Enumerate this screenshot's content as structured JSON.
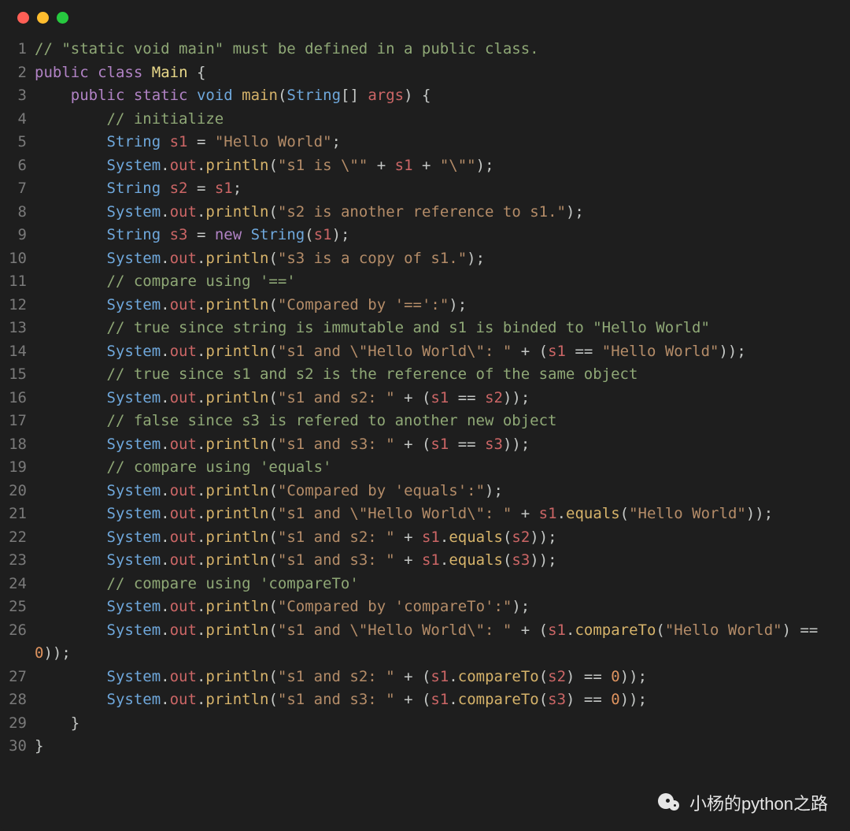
{
  "window": {
    "traffic_light_colors": {
      "close": "#ff5f56",
      "minimize": "#ffbd2e",
      "zoom": "#27c93f"
    }
  },
  "watermark": {
    "text": "小杨的python之路",
    "icon": "wechat-bubble-icon"
  },
  "code_lines": [
    {
      "n": 1,
      "tokens": [
        [
          "comment",
          "// \"static void main\" must be defined in a public class."
        ]
      ]
    },
    {
      "n": 2,
      "tokens": [
        [
          "keyword",
          "public"
        ],
        [
          "plain",
          " "
        ],
        [
          "keyword",
          "class"
        ],
        [
          "plain",
          " "
        ],
        [
          "class",
          "Main"
        ],
        [
          "plain",
          " {"
        ]
      ]
    },
    {
      "n": 3,
      "tokens": [
        [
          "plain",
          "    "
        ],
        [
          "keyword",
          "public"
        ],
        [
          "plain",
          " "
        ],
        [
          "keyword",
          "static"
        ],
        [
          "plain",
          " "
        ],
        [
          "type",
          "void"
        ],
        [
          "plain",
          " "
        ],
        [
          "method",
          "main"
        ],
        [
          "plain",
          "("
        ],
        [
          "type",
          "String"
        ],
        [
          "plain",
          "[] "
        ],
        [
          "var",
          "args"
        ],
        [
          "plain",
          ") {"
        ]
      ]
    },
    {
      "n": 4,
      "tokens": [
        [
          "plain",
          "        "
        ],
        [
          "comment",
          "// initialize"
        ]
      ]
    },
    {
      "n": 5,
      "tokens": [
        [
          "plain",
          "        "
        ],
        [
          "type",
          "String"
        ],
        [
          "plain",
          " "
        ],
        [
          "var",
          "s1"
        ],
        [
          "plain",
          " = "
        ],
        [
          "string",
          "\"Hello World\""
        ],
        [
          "plain",
          ";"
        ]
      ]
    },
    {
      "n": 6,
      "tokens": [
        [
          "plain",
          "        "
        ],
        [
          "type",
          "System"
        ],
        [
          "plain",
          "."
        ],
        [
          "field",
          "out"
        ],
        [
          "plain",
          "."
        ],
        [
          "method",
          "println"
        ],
        [
          "plain",
          "("
        ],
        [
          "string",
          "\"s1 is \\\"\""
        ],
        [
          "plain",
          " + "
        ],
        [
          "var",
          "s1"
        ],
        [
          "plain",
          " + "
        ],
        [
          "string",
          "\"\\\"\""
        ],
        [
          "plain",
          ");"
        ]
      ]
    },
    {
      "n": 7,
      "tokens": [
        [
          "plain",
          "        "
        ],
        [
          "type",
          "String"
        ],
        [
          "plain",
          " "
        ],
        [
          "var",
          "s2"
        ],
        [
          "plain",
          " = "
        ],
        [
          "var",
          "s1"
        ],
        [
          "plain",
          ";"
        ]
      ]
    },
    {
      "n": 8,
      "tokens": [
        [
          "plain",
          "        "
        ],
        [
          "type",
          "System"
        ],
        [
          "plain",
          "."
        ],
        [
          "field",
          "out"
        ],
        [
          "plain",
          "."
        ],
        [
          "method",
          "println"
        ],
        [
          "plain",
          "("
        ],
        [
          "string",
          "\"s2 is another reference to s1.\""
        ],
        [
          "plain",
          ");"
        ]
      ]
    },
    {
      "n": 9,
      "tokens": [
        [
          "plain",
          "        "
        ],
        [
          "type",
          "String"
        ],
        [
          "plain",
          " "
        ],
        [
          "var",
          "s3"
        ],
        [
          "plain",
          " = "
        ],
        [
          "keyword",
          "new"
        ],
        [
          "plain",
          " "
        ],
        [
          "type",
          "String"
        ],
        [
          "plain",
          "("
        ],
        [
          "var",
          "s1"
        ],
        [
          "plain",
          ");"
        ]
      ]
    },
    {
      "n": 10,
      "tokens": [
        [
          "plain",
          "        "
        ],
        [
          "type",
          "System"
        ],
        [
          "plain",
          "."
        ],
        [
          "field",
          "out"
        ],
        [
          "plain",
          "."
        ],
        [
          "method",
          "println"
        ],
        [
          "plain",
          "("
        ],
        [
          "string",
          "\"s3 is a copy of s1.\""
        ],
        [
          "plain",
          ");"
        ]
      ]
    },
    {
      "n": 11,
      "tokens": [
        [
          "plain",
          "        "
        ],
        [
          "comment",
          "// compare using '=='"
        ]
      ]
    },
    {
      "n": 12,
      "tokens": [
        [
          "plain",
          "        "
        ],
        [
          "type",
          "System"
        ],
        [
          "plain",
          "."
        ],
        [
          "field",
          "out"
        ],
        [
          "plain",
          "."
        ],
        [
          "method",
          "println"
        ],
        [
          "plain",
          "("
        ],
        [
          "string",
          "\"Compared by '==':\""
        ],
        [
          "plain",
          ");"
        ]
      ]
    },
    {
      "n": 13,
      "tokens": [
        [
          "plain",
          "        "
        ],
        [
          "comment",
          "// true since string is immutable and s1 is binded to \"Hello World\""
        ]
      ]
    },
    {
      "n": 14,
      "tokens": [
        [
          "plain",
          "        "
        ],
        [
          "type",
          "System"
        ],
        [
          "plain",
          "."
        ],
        [
          "field",
          "out"
        ],
        [
          "plain",
          "."
        ],
        [
          "method",
          "println"
        ],
        [
          "plain",
          "("
        ],
        [
          "string",
          "\"s1 and \\\"Hello World\\\": \""
        ],
        [
          "plain",
          " + ("
        ],
        [
          "var",
          "s1"
        ],
        [
          "plain",
          " == "
        ],
        [
          "string",
          "\"Hello World\""
        ],
        [
          "plain",
          "));"
        ]
      ]
    },
    {
      "n": 15,
      "tokens": [
        [
          "plain",
          "        "
        ],
        [
          "comment",
          "// true since s1 and s2 is the reference of the same object"
        ]
      ]
    },
    {
      "n": 16,
      "tokens": [
        [
          "plain",
          "        "
        ],
        [
          "type",
          "System"
        ],
        [
          "plain",
          "."
        ],
        [
          "field",
          "out"
        ],
        [
          "plain",
          "."
        ],
        [
          "method",
          "println"
        ],
        [
          "plain",
          "("
        ],
        [
          "string",
          "\"s1 and s2: \""
        ],
        [
          "plain",
          " + ("
        ],
        [
          "var",
          "s1"
        ],
        [
          "plain",
          " == "
        ],
        [
          "var",
          "s2"
        ],
        [
          "plain",
          "));"
        ]
      ]
    },
    {
      "n": 17,
      "tokens": [
        [
          "plain",
          "        "
        ],
        [
          "comment",
          "// false since s3 is refered to another new object"
        ]
      ]
    },
    {
      "n": 18,
      "tokens": [
        [
          "plain",
          "        "
        ],
        [
          "type",
          "System"
        ],
        [
          "plain",
          "."
        ],
        [
          "field",
          "out"
        ],
        [
          "plain",
          "."
        ],
        [
          "method",
          "println"
        ],
        [
          "plain",
          "("
        ],
        [
          "string",
          "\"s1 and s3: \""
        ],
        [
          "plain",
          " + ("
        ],
        [
          "var",
          "s1"
        ],
        [
          "plain",
          " == "
        ],
        [
          "var",
          "s3"
        ],
        [
          "plain",
          "));"
        ]
      ]
    },
    {
      "n": 19,
      "tokens": [
        [
          "plain",
          "        "
        ],
        [
          "comment",
          "// compare using 'equals'"
        ]
      ]
    },
    {
      "n": 20,
      "tokens": [
        [
          "plain",
          "        "
        ],
        [
          "type",
          "System"
        ],
        [
          "plain",
          "."
        ],
        [
          "field",
          "out"
        ],
        [
          "plain",
          "."
        ],
        [
          "method",
          "println"
        ],
        [
          "plain",
          "("
        ],
        [
          "string",
          "\"Compared by 'equals':\""
        ],
        [
          "plain",
          ");"
        ]
      ]
    },
    {
      "n": 21,
      "tokens": [
        [
          "plain",
          "        "
        ],
        [
          "type",
          "System"
        ],
        [
          "plain",
          "."
        ],
        [
          "field",
          "out"
        ],
        [
          "plain",
          "."
        ],
        [
          "method",
          "println"
        ],
        [
          "plain",
          "("
        ],
        [
          "string",
          "\"s1 and \\\"Hello World\\\": \""
        ],
        [
          "plain",
          " + "
        ],
        [
          "var",
          "s1"
        ],
        [
          "plain",
          "."
        ],
        [
          "method",
          "equals"
        ],
        [
          "plain",
          "("
        ],
        [
          "string",
          "\"Hello World\""
        ],
        [
          "plain",
          "));"
        ]
      ]
    },
    {
      "n": 22,
      "tokens": [
        [
          "plain",
          "        "
        ],
        [
          "type",
          "System"
        ],
        [
          "plain",
          "."
        ],
        [
          "field",
          "out"
        ],
        [
          "plain",
          "."
        ],
        [
          "method",
          "println"
        ],
        [
          "plain",
          "("
        ],
        [
          "string",
          "\"s1 and s2: \""
        ],
        [
          "plain",
          " + "
        ],
        [
          "var",
          "s1"
        ],
        [
          "plain",
          "."
        ],
        [
          "method",
          "equals"
        ],
        [
          "plain",
          "("
        ],
        [
          "var",
          "s2"
        ],
        [
          "plain",
          "));"
        ]
      ]
    },
    {
      "n": 23,
      "tokens": [
        [
          "plain",
          "        "
        ],
        [
          "type",
          "System"
        ],
        [
          "plain",
          "."
        ],
        [
          "field",
          "out"
        ],
        [
          "plain",
          "."
        ],
        [
          "method",
          "println"
        ],
        [
          "plain",
          "("
        ],
        [
          "string",
          "\"s1 and s3: \""
        ],
        [
          "plain",
          " + "
        ],
        [
          "var",
          "s1"
        ],
        [
          "plain",
          "."
        ],
        [
          "method",
          "equals"
        ],
        [
          "plain",
          "("
        ],
        [
          "var",
          "s3"
        ],
        [
          "plain",
          "));"
        ]
      ]
    },
    {
      "n": 24,
      "tokens": [
        [
          "plain",
          "        "
        ],
        [
          "comment",
          "// compare using 'compareTo'"
        ]
      ]
    },
    {
      "n": 25,
      "tokens": [
        [
          "plain",
          "        "
        ],
        [
          "type",
          "System"
        ],
        [
          "plain",
          "."
        ],
        [
          "field",
          "out"
        ],
        [
          "plain",
          "."
        ],
        [
          "method",
          "println"
        ],
        [
          "plain",
          "("
        ],
        [
          "string",
          "\"Compared by 'compareTo':\""
        ],
        [
          "plain",
          ");"
        ]
      ]
    },
    {
      "n": 26,
      "tokens": [
        [
          "plain",
          "        "
        ],
        [
          "type",
          "System"
        ],
        [
          "plain",
          "."
        ],
        [
          "field",
          "out"
        ],
        [
          "plain",
          "."
        ],
        [
          "method",
          "println"
        ],
        [
          "plain",
          "("
        ],
        [
          "string",
          "\"s1 and \\\"Hello World\\\": \""
        ],
        [
          "plain",
          " + ("
        ],
        [
          "var",
          "s1"
        ],
        [
          "plain",
          "."
        ],
        [
          "method",
          "compareTo"
        ],
        [
          "plain",
          "("
        ],
        [
          "string",
          "\"Hello World\""
        ],
        [
          "plain",
          ") == "
        ],
        [
          "num",
          "0"
        ],
        [
          "plain",
          "));"
        ]
      ]
    },
    {
      "n": 27,
      "tokens": [
        [
          "plain",
          "        "
        ],
        [
          "type",
          "System"
        ],
        [
          "plain",
          "."
        ],
        [
          "field",
          "out"
        ],
        [
          "plain",
          "."
        ],
        [
          "method",
          "println"
        ],
        [
          "plain",
          "("
        ],
        [
          "string",
          "\"s1 and s2: \""
        ],
        [
          "plain",
          " + ("
        ],
        [
          "var",
          "s1"
        ],
        [
          "plain",
          "."
        ],
        [
          "method",
          "compareTo"
        ],
        [
          "plain",
          "("
        ],
        [
          "var",
          "s2"
        ],
        [
          "plain",
          ") == "
        ],
        [
          "num",
          "0"
        ],
        [
          "plain",
          "));"
        ]
      ]
    },
    {
      "n": 28,
      "tokens": [
        [
          "plain",
          "        "
        ],
        [
          "type",
          "System"
        ],
        [
          "plain",
          "."
        ],
        [
          "field",
          "out"
        ],
        [
          "plain",
          "."
        ],
        [
          "method",
          "println"
        ],
        [
          "plain",
          "("
        ],
        [
          "string",
          "\"s1 and s3: \""
        ],
        [
          "plain",
          " + ("
        ],
        [
          "var",
          "s1"
        ],
        [
          "plain",
          "."
        ],
        [
          "method",
          "compareTo"
        ],
        [
          "plain",
          "("
        ],
        [
          "var",
          "s3"
        ],
        [
          "plain",
          ") == "
        ],
        [
          "num",
          "0"
        ],
        [
          "plain",
          "));"
        ]
      ]
    },
    {
      "n": 29,
      "tokens": [
        [
          "plain",
          "    }"
        ]
      ]
    },
    {
      "n": 30,
      "tokens": [
        [
          "plain",
          "}"
        ]
      ]
    }
  ]
}
